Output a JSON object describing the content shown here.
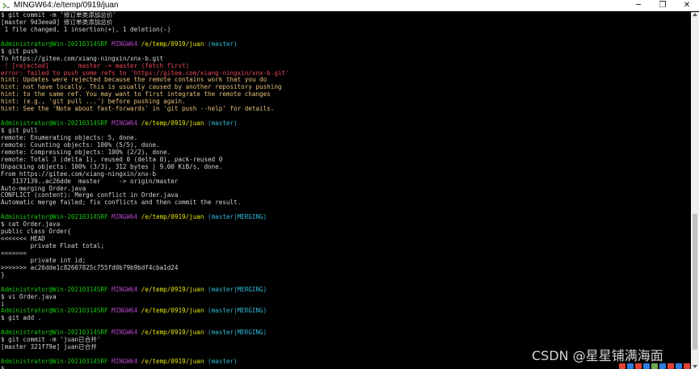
{
  "window": {
    "title": "MINGW64:/e/temp/0919/juan",
    "minimize_glyph": "─",
    "maximize_glyph": "❐",
    "close_glyph": "✕",
    "app_icon": "mingw-icon"
  },
  "terminal": {
    "lines": [
      [
        {
          "t": "$ git commit -m '修订单类添加总价'",
          "c": "default"
        }
      ],
      [
        {
          "t": "[master 9d3eea0] 修订单类添加总价",
          "c": "default"
        }
      ],
      [
        {
          "t": " 1 file changed, 1 insertion(+), 1 deletion(-)",
          "c": "default"
        }
      ],
      [
        {
          "t": "",
          "c": "default"
        }
      ],
      [
        {
          "t": "Administrator@Win-20210314SRF ",
          "c": "green"
        },
        {
          "t": "MINGW64 ",
          "c": "magenta"
        },
        {
          "t": "/e/temp/0919/juan ",
          "c": "yellow"
        },
        {
          "t": "(master)",
          "c": "cyan"
        }
      ],
      [
        {
          "t": "$ git push",
          "c": "default"
        }
      ],
      [
        {
          "t": "To https://gitee.com/xiang-ningxin/xnx-b.git",
          "c": "default"
        }
      ],
      [
        {
          "t": " ! [rejected]        master -> master (fetch first)",
          "c": "red"
        }
      ],
      [
        {
          "t": "error: failed to push some refs to 'https://gitee.com/xiang-ningxin/xnx-b.git'",
          "c": "red"
        }
      ],
      [
        {
          "t": "hint: Updates were rejected because the remote contains work that you do",
          "c": "hint"
        }
      ],
      [
        {
          "t": "hint: not have locally. This is usually caused by another repository pushing",
          "c": "hint"
        }
      ],
      [
        {
          "t": "hint: to the same ref. You may want to first integrate the remote changes",
          "c": "hint"
        }
      ],
      [
        {
          "t": "hint: (e.g., 'git pull ...') before pushing again.",
          "c": "hint"
        }
      ],
      [
        {
          "t": "hint: See the 'Note about fast-forwards' in 'git push --help' for details.",
          "c": "hint"
        }
      ],
      [
        {
          "t": "",
          "c": "default"
        }
      ],
      [
        {
          "t": "Administrator@Win-20210314SRF ",
          "c": "green"
        },
        {
          "t": "MINGW64 ",
          "c": "magenta"
        },
        {
          "t": "/e/temp/0919/juan ",
          "c": "yellow"
        },
        {
          "t": "(master)",
          "c": "cyan"
        }
      ],
      [
        {
          "t": "$ git pull",
          "c": "default"
        }
      ],
      [
        {
          "t": "remote: Enumerating objects: 5, done.",
          "c": "default"
        }
      ],
      [
        {
          "t": "remote: Counting objects: 100% (5/5), done.",
          "c": "default"
        }
      ],
      [
        {
          "t": "remote: Compressing objects: 100% (2/2), done.",
          "c": "default"
        }
      ],
      [
        {
          "t": "remote: Total 3 (delta 1), reused 0 (delta 0), pack-reused 0",
          "c": "default"
        }
      ],
      [
        {
          "t": "Unpacking objects: 100% (3/3), 312 bytes | 9.00 KiB/s, done.",
          "c": "default"
        }
      ],
      [
        {
          "t": "From https://gitee.com/xiang-ningxin/xnx-b",
          "c": "default"
        }
      ],
      [
        {
          "t": "   3137139..ac26dde  master     -> origin/master",
          "c": "default"
        }
      ],
      [
        {
          "t": "Auto-merging Order.java",
          "c": "default"
        }
      ],
      [
        {
          "t": "CONFLICT (content): Merge conflict in Order.java",
          "c": "default"
        }
      ],
      [
        {
          "t": "Automatic merge failed; fix conflicts and then commit the result.",
          "c": "default"
        }
      ],
      [
        {
          "t": "",
          "c": "default"
        }
      ],
      [
        {
          "t": "Administrator@Win-20210314SRF ",
          "c": "green"
        },
        {
          "t": "MINGW64 ",
          "c": "magenta"
        },
        {
          "t": "/e/temp/0919/juan ",
          "c": "yellow"
        },
        {
          "t": "(master|MERGING)",
          "c": "cyan"
        }
      ],
      [
        {
          "t": "$ cat Order.java",
          "c": "default"
        }
      ],
      [
        {
          "t": "public class Order{",
          "c": "default"
        }
      ],
      [
        {
          "t": "<<<<<<< HEAD",
          "c": "default"
        }
      ],
      [
        {
          "t": "        private Float total;",
          "c": "default"
        }
      ],
      [
        {
          "t": "=======",
          "c": "default"
        }
      ],
      [
        {
          "t": "        private int id;",
          "c": "default"
        }
      ],
      [
        {
          "t": ">>>>>>> ac26dde1c82607825c755fd0b79b9bdf4cba1d24",
          "c": "default"
        }
      ],
      [
        {
          "t": "}",
          "c": "default"
        }
      ],
      [
        {
          "t": "",
          "c": "default"
        }
      ],
      [
        {
          "t": "Administrator@Win-20210314SRF ",
          "c": "green"
        },
        {
          "t": "MINGW64 ",
          "c": "magenta"
        },
        {
          "t": "/e/temp/0919/juan ",
          "c": "yellow"
        },
        {
          "t": "(master|MERGING)",
          "c": "cyan"
        }
      ],
      [
        {
          "t": "$ vi Order.java",
          "c": "default"
        }
      ],
      [
        {
          "t": "i",
          "c": "default"
        }
      ],
      [
        {
          "t": "Administrator@Win-20210314SRF ",
          "c": "green"
        },
        {
          "t": "MINGW64 ",
          "c": "magenta"
        },
        {
          "t": "/e/temp/0919/juan ",
          "c": "yellow"
        },
        {
          "t": "(master|MERGING)",
          "c": "cyan"
        }
      ],
      [
        {
          "t": "$ git add .",
          "c": "default"
        }
      ],
      [
        {
          "t": "",
          "c": "default"
        }
      ],
      [
        {
          "t": "Administrator@Win-20210314SRF ",
          "c": "green"
        },
        {
          "t": "MINGW64 ",
          "c": "magenta"
        },
        {
          "t": "/e/temp/0919/juan ",
          "c": "yellow"
        },
        {
          "t": "(master|MERGING)",
          "c": "cyan"
        }
      ],
      [
        {
          "t": "$ git commit -m 'juan已合并'",
          "c": "default"
        }
      ],
      [
        {
          "t": "[master 321f79e] juan已合并",
          "c": "default"
        }
      ],
      [
        {
          "t": "",
          "c": "default"
        }
      ],
      [
        {
          "t": "Administrator@Win-20210314SRF ",
          "c": "green"
        },
        {
          "t": "MINGW64 ",
          "c": "magenta"
        },
        {
          "t": "/e/temp/0919/juan ",
          "c": "yellow"
        },
        {
          "t": "(master)",
          "c": "cyan"
        }
      ],
      [
        {
          "t": "$ ",
          "c": "default"
        }
      ]
    ]
  },
  "watermark": {
    "text": "CSDN @星星铺满海面"
  },
  "tray": {
    "icons": [
      "#e34234",
      "#2f7de1",
      "#e34234",
      "#2f7de1",
      "#6aa84f",
      "#2f7de1",
      "#e34234",
      "#2f7de1",
      "#e34234"
    ]
  },
  "colors": {
    "background": "#000000",
    "prompt_user": "#16c60c",
    "prompt_system": "#b148c6",
    "prompt_path": "#e5e510",
    "prompt_branch": "#2fb8d6",
    "error": "#e74856",
    "hint": "#e5c07b"
  }
}
